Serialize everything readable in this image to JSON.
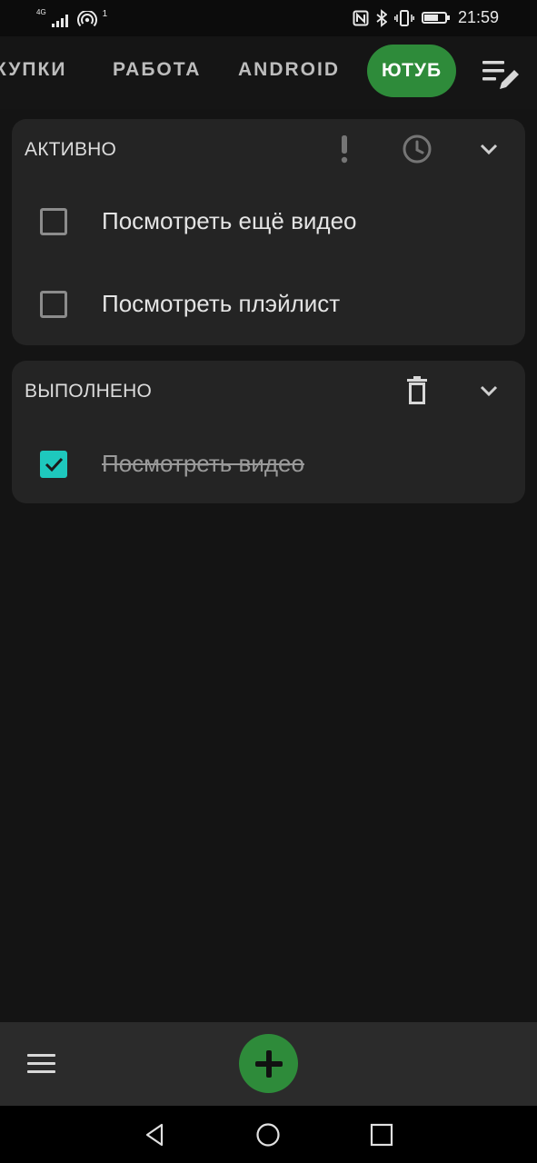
{
  "status_bar": {
    "network": "4G",
    "hotspot_count": "1",
    "time": "21:59",
    "icons": [
      "signal-icon",
      "hotspot-icon",
      "nfc-icon",
      "bluetooth-icon",
      "vibrate-icon",
      "battery-icon"
    ],
    "battery_level": 0.68
  },
  "tabs": {
    "items": [
      "КУПКИ",
      "РАБОТА",
      "ANDROID"
    ],
    "active": "ЮТУБ",
    "edit_icon": "edit-list-icon"
  },
  "active_section": {
    "title": "АКТИВНО",
    "icons": [
      "priority-icon",
      "clock-icon",
      "chevron-down-icon"
    ],
    "items": [
      {
        "text": "Посмотреть ещё видео",
        "checked": false
      },
      {
        "text": "Посмотреть плэйлист",
        "checked": false
      }
    ]
  },
  "done_section": {
    "title": "ВЫПОЛНЕНО",
    "icons": [
      "delete-icon",
      "chevron-down-icon"
    ],
    "items": [
      {
        "text": "Посмотреть видео",
        "checked": true
      }
    ]
  },
  "bottom_bar": {
    "menu_icon": "menu-icon",
    "fab_icon": "plus-icon"
  },
  "colors": {
    "accent": "#2e8b3a",
    "checkbox_checked": "#1ec8bd",
    "card": "#242424",
    "background": "#141414"
  }
}
